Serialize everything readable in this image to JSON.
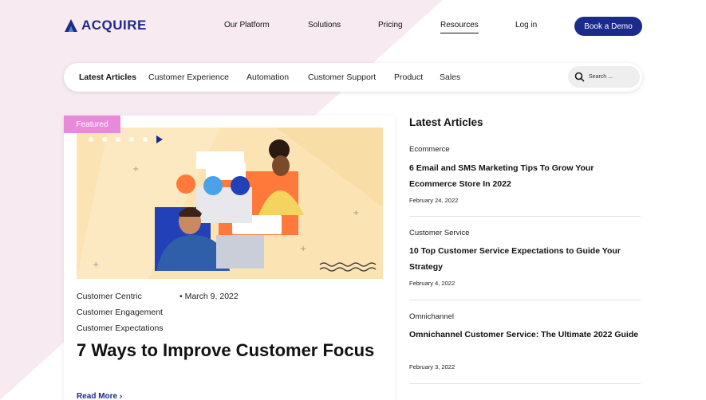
{
  "brand": {
    "name": "ACQUIRE"
  },
  "nav": {
    "items": [
      "Our Platform",
      "Solutions",
      "Pricing",
      "Resources",
      "Log in"
    ],
    "cta": "Book a Demo"
  },
  "categories": {
    "items": [
      "Latest Articles",
      "Customer Experience",
      "Automation",
      "Customer Support",
      "Product",
      "Sales"
    ],
    "search_placeholder": "Search ..."
  },
  "featured": {
    "tag": "Featured",
    "tags": [
      "Customer Centric",
      "Customer Engagement",
      "Customer Expectations"
    ],
    "date": "• March 9, 2022",
    "title": "7 Ways to Improve Customer Focus",
    "read_more": "Read More"
  },
  "sidebar": {
    "title": "Latest Articles",
    "articles": [
      {
        "category": "Ecommerce",
        "title": "6 Email and SMS Marketing Tips To Grow Your Ecommerce Store In 2022",
        "date": "February 24, 2022"
      },
      {
        "category": "Customer Service",
        "title": "10 Top Customer Service Expectations to Guide Your Strategy",
        "date": "February 4, 2022"
      },
      {
        "category": "Omnichannel",
        "title": "Omnichannel Customer Service: The Ultimate 2022 Guide",
        "date": "February 3, 2022"
      }
    ]
  },
  "colors": {
    "brand_blue": "#1a2b8c",
    "featured_pink": "#e78ad8",
    "hero_bg": "#fbe3b3",
    "page_pink": "#f7ebf1"
  },
  "icons": [
    "acquire-logo-icon",
    "search-icon",
    "chevron-right-icon"
  ]
}
